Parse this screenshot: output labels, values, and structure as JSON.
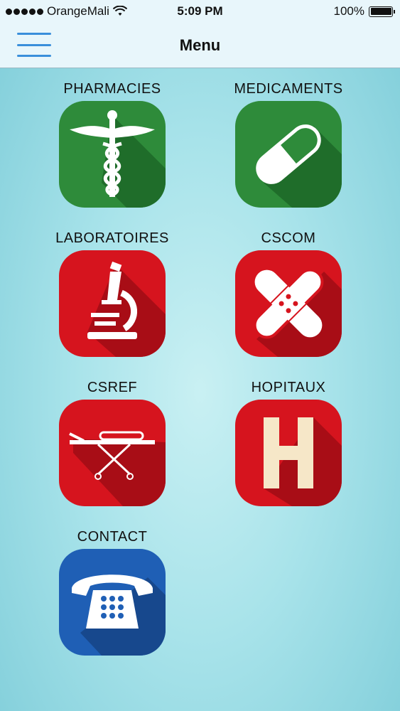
{
  "status_bar": {
    "carrier": "OrangeMali",
    "time": "5:09 PM",
    "battery": "100%"
  },
  "nav": {
    "title": "Menu",
    "menu_icon": "hamburger-menu-icon"
  },
  "menu_items": [
    {
      "label": "PHARMACIES",
      "icon": "caduceus-icon",
      "color": "#2e8b3a"
    },
    {
      "label": "MEDICAMENTS",
      "icon": "pill-capsule-icon",
      "color": "#2e8b3a"
    },
    {
      "label": "LABORATOIRES",
      "icon": "microscope-icon",
      "color": "#d6141e"
    },
    {
      "label": "CSCOM",
      "icon": "bandage-cross-icon",
      "color": "#d6141e"
    },
    {
      "label": "CSREF",
      "icon": "stretcher-icon",
      "color": "#d6141e"
    },
    {
      "label": "HOPITAUX",
      "icon": "hospital-h-icon",
      "color": "#d6141e"
    },
    {
      "label": "CONTACT",
      "icon": "telephone-icon",
      "color": "#1f5fb5"
    }
  ]
}
